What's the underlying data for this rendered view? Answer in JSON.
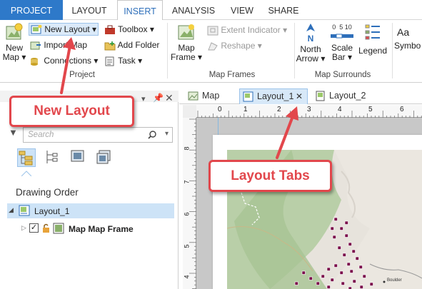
{
  "ribbon_tabs": [
    "PROJECT",
    "LAYOUT",
    "INSERT",
    "ANALYSIS",
    "VIEW",
    "SHARE"
  ],
  "active_tab": "INSERT",
  "project_group": {
    "new_map": "New",
    "new_map_2": "Map",
    "new_layout": "New Layout",
    "import_map": "Import Map",
    "connections": "Connections",
    "toolbox": "Toolbox",
    "add_folder": "Add Folder",
    "task": "Task",
    "label": "Project"
  },
  "map_frames_group": {
    "map_frame": "Map",
    "map_frame_2": "Frame",
    "extent_indicator": "Extent Indicator",
    "reshape": "Reshape",
    "label": "Map Frames"
  },
  "map_surrounds_group": {
    "north_arrow": "North",
    "north_arrow_2": "Arrow",
    "scale_bar": "Scale",
    "scale_bar_2": "Bar",
    "scale_ticks": "0  5 10",
    "legend": "Legend",
    "symbol": "Symbo",
    "label": "Map Surrounds"
  },
  "contents_pane": {
    "search_placeholder": "Search",
    "drawing_order": "Drawing Order",
    "layout_item": "Layout_1",
    "map_frame_item": "Map Map Frame"
  },
  "view_tabs": [
    "Map",
    "Layout_1",
    "Layout_2"
  ],
  "ruler_numbers": [
    "0",
    "1",
    "2",
    "3",
    "4",
    "5",
    "6"
  ],
  "ruler_v_numbers": [
    "8",
    "7",
    "6",
    "5",
    "4"
  ],
  "callouts": {
    "new_layout": "New Layout",
    "layout_tabs": "Layout Tabs"
  },
  "map_labels": {
    "boulder": "Boulder"
  },
  "colors": {
    "accent": "#2e79c9",
    "callout": "#e2474c",
    "marker": "#7a0a4a"
  }
}
